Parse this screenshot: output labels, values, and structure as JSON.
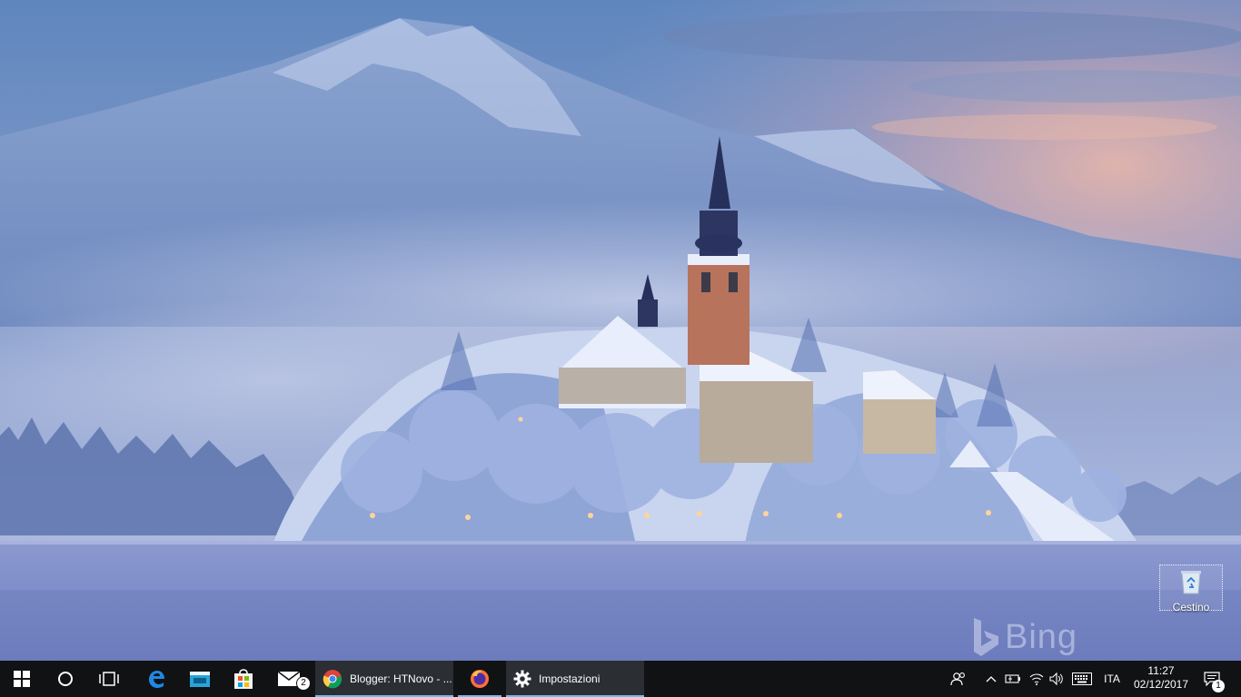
{
  "desktop": {
    "wallpaper_watermark": "Bing",
    "icons": [
      {
        "label": "Cestino",
        "icon": "recycle-bin-icon"
      }
    ]
  },
  "taskbar": {
    "start": {
      "icon": "windows-logo-icon"
    },
    "cortana": {
      "icon": "cortana-circle-icon"
    },
    "task_view": {
      "icon": "task-view-icon"
    },
    "pinned": [
      {
        "name": "edge",
        "icon": "edge-icon"
      },
      {
        "name": "file-explorer",
        "icon": "folder-icon"
      },
      {
        "name": "store",
        "icon": "store-bag-icon"
      },
      {
        "name": "mail",
        "icon": "mail-icon",
        "badge": "2"
      }
    ],
    "running": [
      {
        "label": "Blogger: HTNovo - ...",
        "icon": "chrome-icon"
      },
      {
        "name": "firefox",
        "icon": "firefox-icon"
      },
      {
        "label": "Impostazioni",
        "icon": "gear-icon"
      }
    ],
    "tray": {
      "people_icon": "people-icon",
      "overflow_icon": "chevron-up-icon",
      "battery_icon": "battery-plug-icon",
      "network_icon": "wifi-icon",
      "volume_icon": "speaker-icon",
      "keyboard_icon": "keyboard-icon",
      "language": "ITA",
      "time": "11:27",
      "date": "02/12/2017",
      "notifications_icon": "action-center-icon",
      "notifications_count": "1"
    }
  },
  "colors": {
    "taskbar_bg": "#101214",
    "active_app_bg": "#2b2e33",
    "accent": "#76b9ed"
  }
}
